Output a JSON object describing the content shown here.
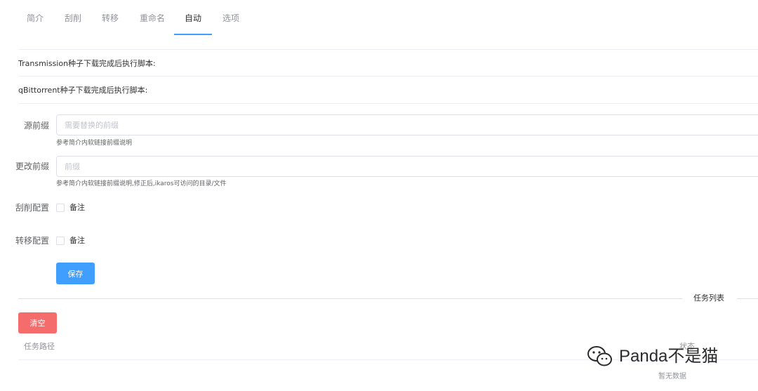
{
  "tabs": [
    {
      "label": "简介"
    },
    {
      "label": "刮削"
    },
    {
      "label": "转移"
    },
    {
      "label": "重命名"
    },
    {
      "label": "自动",
      "active": true
    },
    {
      "label": "选项"
    }
  ],
  "scripts": {
    "transmission_label": "Transmission种子下载完成后执行脚本:",
    "qbittorrent_label": "qBittorrent种子下载完成后执行脚本:"
  },
  "form": {
    "source_prefix": {
      "label": "源前缀",
      "value": "",
      "placeholder": "需要替换的前缀",
      "help": "参考简介内软链接前缀说明"
    },
    "change_prefix": {
      "label": "更改前缀",
      "value": "",
      "placeholder": "前缀",
      "help": "参考简介内软链接前缀说明,修正后,ikaros可访问的目录/文件"
    },
    "scrape_config": {
      "label": "刮削配置",
      "checkbox_label": "备注",
      "checked": false
    },
    "transfer_config": {
      "label": "转移配置",
      "checkbox_label": "备注",
      "checked": false
    },
    "save_label": "保存"
  },
  "task_list": {
    "divider_title": "任务列表",
    "clear_label": "清空",
    "columns": [
      "任务路径",
      "状态"
    ],
    "empty_text": "暂无数据"
  },
  "watermark": {
    "text": "Panda不是猫"
  },
  "colors": {
    "primary": "#409eff",
    "danger": "#f56c6c",
    "border": "#dcdfe6"
  }
}
